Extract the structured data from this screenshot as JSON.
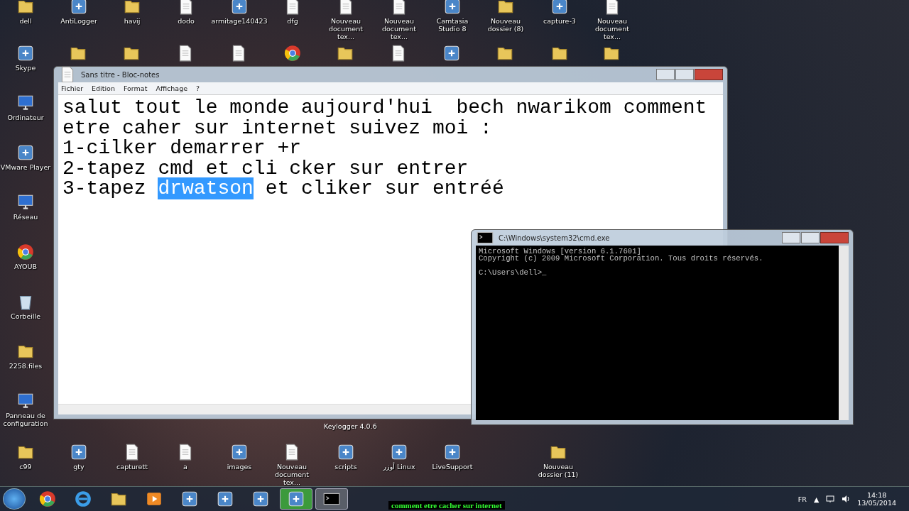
{
  "desktop": {
    "top_icons": [
      {
        "label": "dell",
        "kind": "folder"
      },
      {
        "label": "AntiLogger",
        "kind": "app"
      },
      {
        "label": "havij",
        "kind": "folder"
      },
      {
        "label": "dodo",
        "kind": "document"
      },
      {
        "label": "armitage140423",
        "kind": "app"
      },
      {
        "label": "dfg",
        "kind": "document"
      },
      {
        "label": "Nouveau document tex...",
        "kind": "document"
      },
      {
        "label": "Nouveau document tex...",
        "kind": "document"
      },
      {
        "label": "Camtasia Studio 8",
        "kind": "app"
      },
      {
        "label": "Nouveau dossier (8)",
        "kind": "folder"
      },
      {
        "label": "capture-3",
        "kind": "app"
      },
      {
        "label": "Nouveau document tex...",
        "kind": "document"
      }
    ],
    "second_row_icons": [
      {
        "kind": "folder"
      },
      {
        "kind": "folder"
      },
      {
        "kind": "document"
      },
      {
        "kind": "document"
      },
      {
        "kind": "browser"
      },
      {
        "kind": "folder"
      },
      {
        "kind": "document"
      },
      {
        "kind": "app"
      },
      {
        "kind": "folder"
      },
      {
        "kind": "folder"
      },
      {
        "kind": "folder"
      }
    ],
    "left_icons": [
      {
        "label": "Skype",
        "kind": "app"
      },
      {
        "label": "Ordinateur",
        "kind": "computer"
      },
      {
        "label": "VMware Player",
        "kind": "app"
      },
      {
        "label": "Réseau",
        "kind": "computer"
      },
      {
        "label": "AYOUB",
        "kind": "browser"
      },
      {
        "label": "Corbeille",
        "kind": "bin"
      },
      {
        "label": "2258.files",
        "kind": "folder"
      },
      {
        "label": "Panneau de configuration",
        "kind": "computer"
      }
    ],
    "bottom_icons": [
      {
        "label": "c99",
        "kind": "folder"
      },
      {
        "label": "gty",
        "kind": "app"
      },
      {
        "label": "capturett",
        "kind": "document"
      },
      {
        "label": "a",
        "kind": "document"
      },
      {
        "label": "images",
        "kind": "app"
      },
      {
        "label": "Nouveau document tex...",
        "kind": "document"
      },
      {
        "label": "scripts",
        "kind": "app"
      },
      {
        "label": "أوزر Linux",
        "kind": "app"
      },
      {
        "label": "LiveSupport",
        "kind": "app"
      },
      {
        "label": "Nouveau dossier (11)",
        "kind": "folder"
      }
    ],
    "hidden_label": "Keylogger 4.0.6"
  },
  "notepad": {
    "title": "Sans titre - Bloc-notes",
    "menu": [
      "Fichier",
      "Edition",
      "Format",
      "Affichage",
      "?"
    ],
    "lines": [
      [
        {
          "text": "salut tout le monde aujourd'hui  bech nwarikom comment",
          "selected": false
        }
      ],
      [
        {
          "text": "etre caher sur internet suivez moi :",
          "selected": false
        }
      ],
      [
        {
          "text": "1-cilker demarrer +r",
          "selected": false
        }
      ],
      [
        {
          "text": "2-tapez cmd et cli cker sur entrer",
          "selected": false
        }
      ],
      [
        {
          "text": "3-tapez ",
          "selected": false
        },
        {
          "text": "drwatson",
          "selected": true
        },
        {
          "text": " et cliker sur entréé",
          "selected": false
        }
      ]
    ]
  },
  "cmd": {
    "title": "C:\\Windows\\system32\\cmd.exe",
    "lines": [
      "Microsoft Windows [version 6.1.7601]",
      "Copyright (c) 2009 Microsoft Corporation. Tous droits réservés."
    ],
    "prompt": "C:\\Users\\dell>_"
  },
  "taskbar": {
    "apps": [
      {
        "kind": "browser",
        "selected": false
      },
      {
        "kind": "ie",
        "selected": false
      },
      {
        "kind": "folder",
        "selected": false
      },
      {
        "kind": "media",
        "selected": false
      },
      {
        "kind": "app",
        "selected": false
      },
      {
        "kind": "app",
        "selected": false
      },
      {
        "kind": "app",
        "selected": false
      },
      {
        "kind": "app",
        "selected": true
      },
      {
        "kind": "console",
        "selected": true
      }
    ],
    "language": "FR",
    "tray_arrow": "▲",
    "time": "14:18",
    "date": "13/05/2014"
  },
  "caption": "comment etre cacher sur internet"
}
